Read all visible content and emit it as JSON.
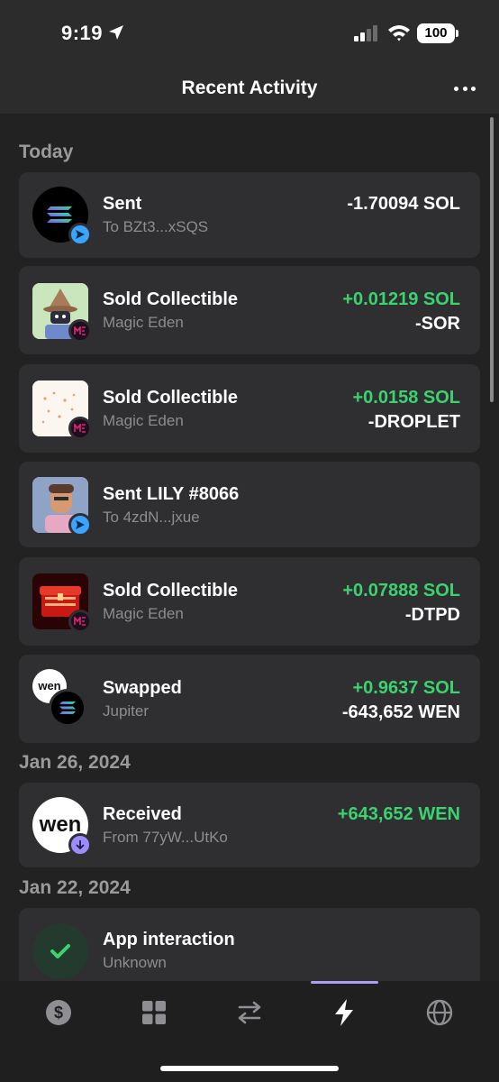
{
  "status_bar": {
    "time": "9:19",
    "battery": "100"
  },
  "header": {
    "title": "Recent Activity"
  },
  "colors": {
    "positive": "#3bd36f",
    "accent": "#ab9ff2",
    "send_badge": "#3aa4ff"
  },
  "sections": [
    {
      "date": "Today",
      "items": [
        {
          "title": "Sent",
          "subtitle": "To BZt3...xSQS",
          "amounts": [
            "-1.70094 SOL"
          ],
          "icon": "solana-icon",
          "badge": "send-arrow-icon"
        },
        {
          "title": "Sold Collectible",
          "subtitle": "Magic Eden",
          "amounts": [
            "+0.01219 SOL",
            "-SOR"
          ],
          "icon": "sor-nft-thumbnail",
          "badge": "magic-eden-icon"
        },
        {
          "title": "Sold Collectible",
          "subtitle": "Magic Eden",
          "amounts": [
            "+0.0158 SOL",
            "-DROPLET"
          ],
          "icon": "droplet-nft-thumbnail",
          "badge": "magic-eden-icon"
        },
        {
          "title": "Sent LILY #8066",
          "subtitle": "To 4zdN...jxue",
          "amounts": [],
          "icon": "lily-nft-thumbnail",
          "badge": "send-arrow-icon"
        },
        {
          "title": "Sold Collectible",
          "subtitle": "Magic Eden",
          "amounts": [
            "+0.07888 SOL",
            "-DTPD"
          ],
          "icon": "dtpd-nft-thumbnail",
          "badge": "magic-eden-icon"
        },
        {
          "title": "Swapped",
          "subtitle": "Jupiter",
          "amounts": [
            "+0.9637 SOL",
            "-643,652 WEN"
          ],
          "icon": "wen-solana-swap-icon",
          "badge": ""
        }
      ]
    },
    {
      "date": "Jan 26, 2024",
      "items": [
        {
          "title": "Received",
          "subtitle": "From 77yW...UtKo",
          "amounts": [
            "+643,652 WEN"
          ],
          "icon": "wen-token-icon",
          "badge": "receive-arrow-icon"
        }
      ]
    },
    {
      "date": "Jan 22, 2024",
      "items": [
        {
          "title": "App interaction",
          "subtitle": "Unknown",
          "amounts": [],
          "icon": "checkmark-icon",
          "badge": ""
        }
      ]
    }
  ],
  "wen_logo_text": "wen",
  "tabs": [
    {
      "name": "wallet-tab",
      "icon": "dollar-icon"
    },
    {
      "name": "collectibles-tab",
      "icon": "grid-icon"
    },
    {
      "name": "swap-tab",
      "icon": "swap-arrows-icon"
    },
    {
      "name": "activity-tab",
      "icon": "lightning-icon",
      "active": true
    },
    {
      "name": "explore-tab",
      "icon": "globe-icon"
    }
  ]
}
